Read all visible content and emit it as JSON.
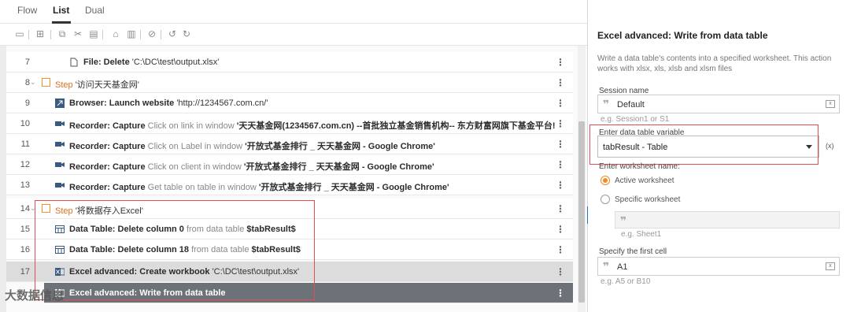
{
  "tabs": [
    {
      "label": "Flow"
    },
    {
      "label": "List"
    },
    {
      "label": "Dual"
    }
  ],
  "toolbar": {
    "icons": [
      "run-icon",
      "screen-icon",
      "copy-icon",
      "cut-icon",
      "paste-icon",
      "lock-icon",
      "delete-icon",
      "disable-icon",
      "undo-icon",
      "redo-icon"
    ]
  },
  "rows": [
    {
      "num": "7",
      "icon": "file-icon",
      "bold": "File: Delete",
      "rest": "'C:\\DC\\test\\output.xlsx'"
    },
    {
      "num": "8",
      "step": "Step",
      "title": "'访问天天基金网'"
    },
    {
      "num": "9",
      "icon": "browser-icon",
      "bold": "Browser: Launch website",
      "rest": "'http://1234567.com.cn/'"
    },
    {
      "num": "10",
      "icon": "camera-icon",
      "bold": "Recorder: Capture",
      "grey": "Click on link in window",
      "rest": "'天天基金网(1234567.com.cn) --首批独立基金销售机构-- 东方财富网旗下基金平台! - Google Ch..."
    },
    {
      "num": "11",
      "icon": "camera-icon",
      "bold": "Recorder: Capture",
      "grey": "Click on Label in window",
      "rest": "'开放式基金排行 _ 天天基金网 - Google Chrome'"
    },
    {
      "num": "12",
      "icon": "camera-icon",
      "bold": "Recorder: Capture",
      "grey": "Click on client in window",
      "rest": "'开放式基金排行 _ 天天基金网 - Google Chrome'"
    },
    {
      "num": "13",
      "icon": "camera-icon",
      "bold": "Recorder: Capture",
      "grey": "Get table on table in window",
      "rest": "'开放式基金排行 _ 天天基金网 - Google Chrome'"
    },
    {
      "num": "14",
      "step": "Step",
      "title": "'将数据存入Excel'"
    },
    {
      "num": "15",
      "icon": "table-icon",
      "bold": "Data Table: Delete column 0",
      "grey": "from data table",
      "rest": "$tabResult$"
    },
    {
      "num": "16",
      "icon": "table-icon",
      "bold": "Data Table: Delete column 18",
      "grey": "from data table",
      "rest": "$tabResult$"
    },
    {
      "num": "17",
      "icon": "excel-icon",
      "bold": "Excel advanced: Create workbook",
      "rest": "'C:\\DC\\test\\output.xlsx'"
    },
    {
      "num": "18",
      "icon": "excel-icon",
      "bold": "Excel advanced: Write from data table",
      "rest": ""
    }
  ],
  "panel": {
    "title": "Excel advanced: Write from data table",
    "description": "Write a data table's contents into a specified worksheet. This action works with xlsx, xls, xlsb and xlsm files",
    "session_label": "Session name",
    "session_value": "Default",
    "session_hint": "e.g. Session1 or S1",
    "table_label": "Enter data table variable",
    "table_value": "tabResult - Table",
    "fx": "(x)",
    "ws_label": "Enter worksheet name:",
    "radio_active": "Active worksheet",
    "radio_specific": "Specific worksheet",
    "sheet_hint": "e.g. Sheet1",
    "cell_label": "Specify the first cell",
    "cell_value": "A1",
    "cell_hint": "e.g. A5 or B10"
  },
  "watermark": "大数据信息",
  "colors": {
    "accent": "#f08a24",
    "highlight": "#e05050",
    "selected": "#6d7278"
  }
}
